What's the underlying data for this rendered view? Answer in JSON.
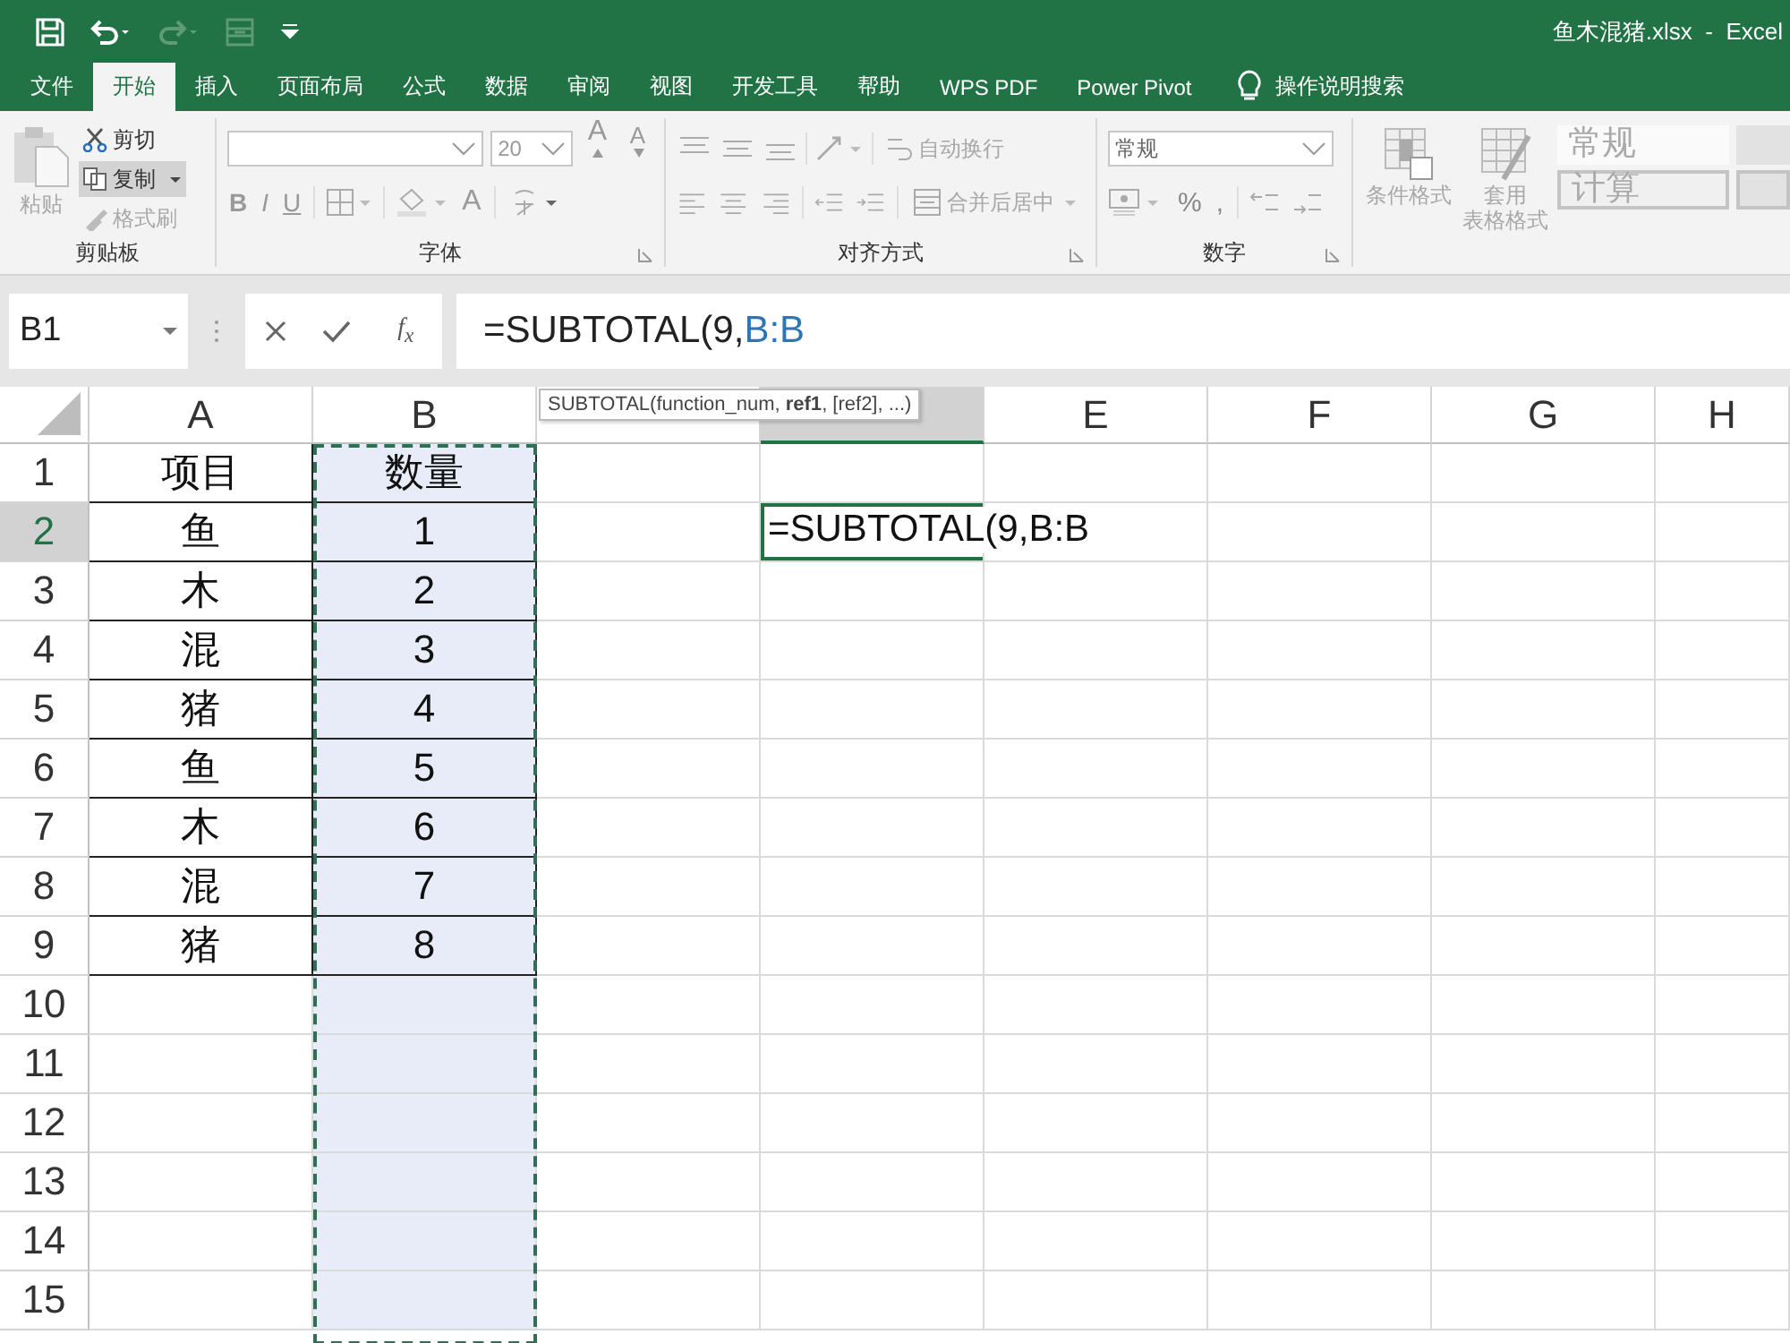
{
  "window": {
    "title": "鱼木混猪.xlsx  -  Excel"
  },
  "tabs": [
    {
      "label": "文件",
      "selected": false
    },
    {
      "label": "开始",
      "selected": true
    },
    {
      "label": "插入",
      "selected": false
    },
    {
      "label": "页面布局",
      "selected": false
    },
    {
      "label": "公式",
      "selected": false
    },
    {
      "label": "数据",
      "selected": false
    },
    {
      "label": "审阅",
      "selected": false
    },
    {
      "label": "视图",
      "selected": false
    },
    {
      "label": "开发工具",
      "selected": false
    },
    {
      "label": "帮助",
      "selected": false
    },
    {
      "label": "WPS PDF",
      "selected": false
    },
    {
      "label": "Power Pivot",
      "selected": false
    }
  ],
  "tell_me": {
    "placeholder": "操作说明搜索"
  },
  "ribbon": {
    "clipboard": {
      "label": "剪贴板",
      "paste": {
        "label": "粘贴",
        "disabled": true
      },
      "cut": {
        "label": "剪切",
        "disabled": false
      },
      "copy": {
        "label": "复制",
        "disabled": false
      },
      "format_painter": {
        "label": "格式刷",
        "disabled": true
      }
    },
    "font": {
      "label": "字体",
      "font_size": "20",
      "grow": "A",
      "shrink": "A",
      "bold": "B",
      "italic": "I",
      "underline": "U",
      "font_color": "A"
    },
    "alignment": {
      "label": "对齐方式",
      "wrap_text": {
        "label": "自动换行",
        "disabled": true
      },
      "merge": {
        "label": "合并后居中",
        "disabled": true
      }
    },
    "number": {
      "label": "数字",
      "format": "常规",
      "percent": "%",
      "comma": ","
    },
    "styles": {
      "conditional": {
        "label": "条件格式",
        "disabled": true
      },
      "table_format": {
        "label": "套用",
        "label_2": "表格格式",
        "disabled": true
      },
      "cell_styles": [
        {
          "label": "常规",
          "kind": "normal"
        },
        {
          "label": "计算",
          "kind": "calc"
        }
      ]
    }
  },
  "formula_bar": {
    "name_box": "B1",
    "function_button": "f$_{x}$",
    "formula": [
      {
        "text": "=SUBTOTAL(9,",
        "kind": "plain"
      },
      {
        "text": "B:B",
        "kind": "ref"
      }
    ]
  },
  "tooltip": "SUBTOTAL(function_num, **ref1**, [ref2], ...)",
  "grid": {
    "columns": [
      {
        "label": "A",
        "highlighted": false,
        "marquee": false
      },
      {
        "label": "B",
        "highlighted": false,
        "marquee": true
      },
      {
        "highlighted": false,
        "marquee": false
      },
      {
        "highlighted": true,
        "marquee": false
      },
      {
        "label": "E",
        "highlighted": false,
        "marquee": false
      },
      {
        "label": "F",
        "highlighted": false,
        "marquee": false
      },
      {
        "label": "G",
        "highlighted": false,
        "marquee": false
      },
      {
        "label": "H",
        "highlighted": false,
        "marquee": false
      }
    ],
    "rows": [
      {
        "label": "1",
        "highlighted": false,
        "cells": [
          {
            "text": "项目",
            "kind": "table"
          },
          {
            "text": "数量",
            "kind": "table"
          }
        ]
      },
      {
        "label": "2",
        "highlighted": true,
        "cells": [
          {
            "text": "鱼",
            "kind": "table"
          },
          {
            "text": "1",
            "kind": "table"
          },
          {
            "kind": "empty"
          },
          {
            "text": "=SUBTOTAL(9,B:B",
            "kind": "editing"
          }
        ]
      },
      {
        "label": "3",
        "highlighted": false,
        "cells": [
          {
            "text": "木",
            "kind": "table"
          },
          {
            "text": "2",
            "kind": "table"
          }
        ]
      },
      {
        "label": "4",
        "highlighted": false,
        "cells": [
          {
            "text": "混",
            "kind": "table"
          },
          {
            "text": "3",
            "kind": "table"
          }
        ]
      },
      {
        "label": "5",
        "highlighted": false,
        "cells": [
          {
            "text": "猪",
            "kind": "table"
          },
          {
            "text": "4",
            "kind": "table"
          }
        ]
      },
      {
        "label": "6",
        "highlighted": false,
        "cells": [
          {
            "text": "鱼",
            "kind": "table"
          },
          {
            "text": "5",
            "kind": "table"
          }
        ]
      },
      {
        "label": "7",
        "highlighted": false,
        "cells": [
          {
            "text": "木",
            "kind": "table"
          },
          {
            "text": "6",
            "kind": "table"
          }
        ]
      },
      {
        "label": "8",
        "highlighted": false,
        "cells": [
          {
            "text": "混",
            "kind": "table"
          },
          {
            "text": "7",
            "kind": "table"
          }
        ]
      },
      {
        "label": "9",
        "highlighted": false,
        "cells": [
          {
            "text": "猪",
            "kind": "table"
          },
          {
            "text": "8",
            "kind": "table"
          }
        ]
      },
      {
        "label": "10",
        "highlighted": false
      },
      {
        "label": "11",
        "highlighted": false
      },
      {
        "label": "12",
        "highlighted": false
      },
      {
        "label": "13",
        "highlighted": false
      },
      {
        "label": "14",
        "highlighted": false
      },
      {
        "label": "15",
        "highlighted": false
      }
    ]
  }
}
